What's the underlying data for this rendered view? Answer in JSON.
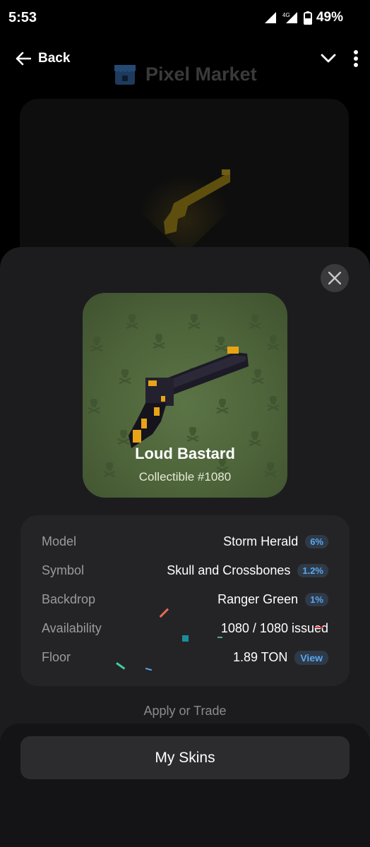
{
  "status_bar": {
    "time": "5:53",
    "network": "4G",
    "battery": "49%"
  },
  "header": {
    "back_label": "Back",
    "app_name": "Pixel Market"
  },
  "item": {
    "name": "Loud Bastard",
    "number": "Collectible #1080"
  },
  "attributes": [
    {
      "key": "Model",
      "value": "Storm Herald",
      "badge": "6%"
    },
    {
      "key": "Symbol",
      "value": "Skull and Crossbones",
      "badge": "1.2%"
    },
    {
      "key": "Backdrop",
      "value": "Ranger Green",
      "badge": "1%"
    },
    {
      "key": "Availability",
      "value": "1080 / 1080 issued",
      "badge": ""
    },
    {
      "key": "Floor",
      "value": "1.89 TON",
      "badge": "View"
    }
  ],
  "actions": {
    "section_label": "Apply or Trade",
    "my_skins_label": "My Skins"
  },
  "colors": {
    "sheet": "#1c1c1e",
    "backdrop": "#4d6339",
    "accent": "#5aa7f0",
    "gold": "#e8a417"
  },
  "icons": [
    "back-arrow-icon",
    "chevron-down-icon",
    "more-vert-icon",
    "store-icon",
    "close-icon",
    "skull-icon",
    "revolver-icon"
  ]
}
